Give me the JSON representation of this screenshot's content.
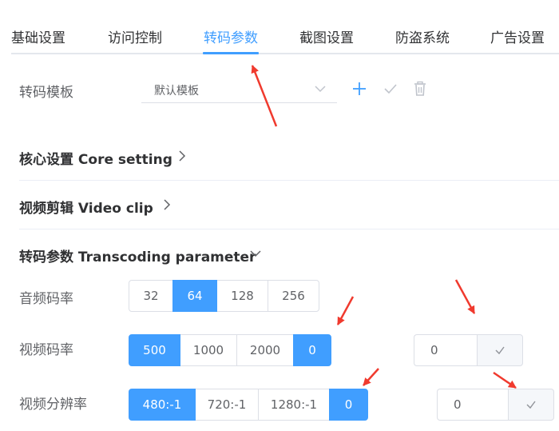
{
  "tabs": [
    {
      "label": "基础设置",
      "active": false
    },
    {
      "label": "访问控制",
      "active": false
    },
    {
      "label": "转码参数",
      "active": true
    },
    {
      "label": "截图设置",
      "active": false
    },
    {
      "label": "防盗系统",
      "active": false
    },
    {
      "label": "广告设置",
      "active": false
    }
  ],
  "template": {
    "label": "转码模板",
    "selected": "默认模板",
    "icons": [
      "plus-icon",
      "check-icon",
      "trash-icon"
    ]
  },
  "sections": {
    "core": "核心设置 Core setting",
    "clip": "视频剪辑 Video clip",
    "transcoding": "转码参数 Transcoding parameter"
  },
  "audio_bitrate": {
    "label": "音频码率",
    "options": [
      "32",
      "64",
      "128",
      "256"
    ],
    "selected": "64"
  },
  "video_bitrate": {
    "label": "视频码率",
    "options": [
      "500",
      "1000",
      "2000",
      "0"
    ],
    "selected": [
      "500",
      "0"
    ],
    "custom_value": "0"
  },
  "resolution": {
    "label": "视频分辨率",
    "options": [
      "480:-1",
      "720:-1",
      "1280:-1",
      "0"
    ],
    "selected": [
      "480:-1",
      "0"
    ],
    "custom_value": "0"
  },
  "colors": {
    "accent": "#409eff",
    "annotation": "#f03a2e"
  }
}
